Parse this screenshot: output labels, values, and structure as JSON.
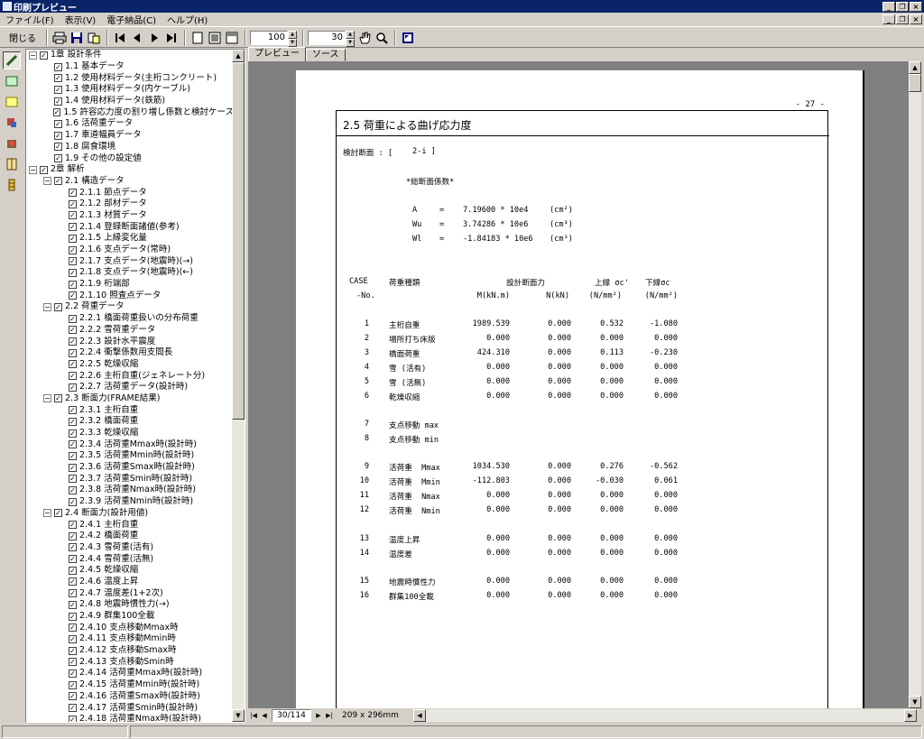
{
  "window": {
    "title": "印刷プレビュー"
  },
  "menu": [
    "ファイル(F)",
    "表示(V)",
    "電子納品(C)",
    "ヘルプ(H)"
  ],
  "toolbar": {
    "close_label": "閉じる",
    "zoom_value": "100",
    "lines_value": "30"
  },
  "tree": [
    {
      "level": 0,
      "label": "1章 設計条件",
      "expanded": true
    },
    {
      "level": 1,
      "label": "1.1 基本データ"
    },
    {
      "level": 1,
      "label": "1.2 使用材料データ(主桁コンクリート)"
    },
    {
      "level": 1,
      "label": "1.3 使用材料データ(内ケーブル)"
    },
    {
      "level": 1,
      "label": "1.4 使用材料データ(鉄筋)"
    },
    {
      "level": 1,
      "label": "1.5 許容応力度の割り増し係数と検討ケース"
    },
    {
      "level": 1,
      "label": "1.6 活荷重データ"
    },
    {
      "level": 1,
      "label": "1.7 車道幅員データ"
    },
    {
      "level": 1,
      "label": "1.8 腐食環境"
    },
    {
      "level": 1,
      "label": "1.9 その他の設定値"
    },
    {
      "level": 0,
      "label": "2章 解析",
      "expanded": true
    },
    {
      "level": 1,
      "label": "2.1 構造データ",
      "expanded": true
    },
    {
      "level": 2,
      "label": "2.1.1 節点データ"
    },
    {
      "level": 2,
      "label": "2.1.2 部材データ"
    },
    {
      "level": 2,
      "label": "2.1.3 材質データ"
    },
    {
      "level": 2,
      "label": "2.1.4 登録断面諸値(参考)"
    },
    {
      "level": 2,
      "label": "2.1.5 上縁変化量"
    },
    {
      "level": 2,
      "label": "2.1.6 支点データ(常時)"
    },
    {
      "level": 2,
      "label": "2.1.7 支点データ(地震時)(→)"
    },
    {
      "level": 2,
      "label": "2.1.8 支点データ(地震時)(←)"
    },
    {
      "level": 2,
      "label": "2.1.9 桁端部"
    },
    {
      "level": 2,
      "label": "2.1.10 照査点データ"
    },
    {
      "level": 1,
      "label": "2.2 荷重データ",
      "expanded": true
    },
    {
      "level": 2,
      "label": "2.2.1 橋面荷重扱いの分布荷重"
    },
    {
      "level": 2,
      "label": "2.2.2 雪荷重データ"
    },
    {
      "level": 2,
      "label": "2.2.3 設計水平震度"
    },
    {
      "level": 2,
      "label": "2.2.4 衝撃係数用支間長"
    },
    {
      "level": 2,
      "label": "2.2.5 乾燥収縮"
    },
    {
      "level": 2,
      "label": "2.2.6 主桁自重(ジェネレート分)"
    },
    {
      "level": 2,
      "label": "2.2.7 活荷重データ(設計時)"
    },
    {
      "level": 1,
      "label": "2.3 断面力(FRAME結果)",
      "expanded": true
    },
    {
      "level": 2,
      "label": "2.3.1 主桁自重"
    },
    {
      "level": 2,
      "label": "2.3.2 橋面荷重"
    },
    {
      "level": 2,
      "label": "2.3.3 乾燥収縮"
    },
    {
      "level": 2,
      "label": "2.3.4 活荷重Mmax時(設計時)"
    },
    {
      "level": 2,
      "label": "2.3.5 活荷重Mmin時(設計時)"
    },
    {
      "level": 2,
      "label": "2.3.6 活荷重Smax時(設計時)"
    },
    {
      "level": 2,
      "label": "2.3.7 活荷重Smin時(設計時)"
    },
    {
      "level": 2,
      "label": "2.3.8 活荷重Nmax時(設計時)"
    },
    {
      "level": 2,
      "label": "2.3.9 活荷重Nmin時(設計時)"
    },
    {
      "level": 1,
      "label": "2.4 断面力(設計用値)",
      "expanded": true
    },
    {
      "level": 2,
      "label": "2.4.1 主桁自重"
    },
    {
      "level": 2,
      "label": "2.4.2 橋面荷重"
    },
    {
      "level": 2,
      "label": "2.4.3 雪荷重(活有)"
    },
    {
      "level": 2,
      "label": "2.4.4 雪荷重(活無)"
    },
    {
      "level": 2,
      "label": "2.4.5 乾燥収縮"
    },
    {
      "level": 2,
      "label": "2.4.6 温度上昇"
    },
    {
      "level": 2,
      "label": "2.4.7 温度差(1+2次)"
    },
    {
      "level": 2,
      "label": "2.4.8 地震時慣性力(→)"
    },
    {
      "level": 2,
      "label": "2.4.9 群集100全載"
    },
    {
      "level": 2,
      "label": "2.4.10 支点移動Mmax時"
    },
    {
      "level": 2,
      "label": "2.4.11 支点移動Mmin時"
    },
    {
      "level": 2,
      "label": "2.4.12 支点移動Smax時"
    },
    {
      "level": 2,
      "label": "2.4.13 支点移動Smin時"
    },
    {
      "level": 2,
      "label": "2.4.14 活荷重Mmax時(設計時)"
    },
    {
      "level": 2,
      "label": "2.4.15 活荷重Mmin時(設計時)"
    },
    {
      "level": 2,
      "label": "2.4.16 活荷重Smax時(設計時)"
    },
    {
      "level": 2,
      "label": "2.4.17 活荷重Smin時(設計時)"
    },
    {
      "level": 2,
      "label": "2.4.18 活荷重Nmax時(設計時)"
    }
  ],
  "tabs": {
    "preview": "プレビュー",
    "source": "ソース"
  },
  "page": {
    "page_number": "- 27 -",
    "section_title": "2.5 荷重による曲げ応力度",
    "check_section_label": "検討断面 : [",
    "check_section_value": "2-i ]",
    "props_title": "*総断面係数*",
    "props": [
      {
        "sym": "A",
        "eq": "=",
        "val": "7.19600 * 10e4",
        "unit": "(cm²)"
      },
      {
        "sym": "Wu",
        "eq": "=",
        "val": "3.74286 * 10e6",
        "unit": "(cm³)"
      },
      {
        "sym": "Wl",
        "eq": "=",
        "val": "-1.84183 * 10e6",
        "unit": "(cm³)"
      }
    ],
    "header1": {
      "case": "CASE",
      "type": "荷重種類",
      "design": "設計断面力",
      "upper": "上縁 σc'",
      "lower": "下縁σc"
    },
    "header2": {
      "no": "-No.",
      "m": "M(kN.m)",
      "n": "N(kN)",
      "upper": "(N/mm²)",
      "lower": "(N/mm²)"
    },
    "rows": [
      {
        "no": "1",
        "name": "主桁自重",
        "m": "1989.539",
        "n": "0.000",
        "u": "0.532",
        "l": "-1.080",
        "gap": 0
      },
      {
        "no": "2",
        "name": "場所打ち床版",
        "m": "0.000",
        "n": "0.000",
        "u": "0.000",
        "l": "0.000",
        "gap": 0
      },
      {
        "no": "3",
        "name": "橋面荷重",
        "m": "424.310",
        "n": "0.000",
        "u": "0.113",
        "l": "-0.230",
        "gap": 0
      },
      {
        "no": "4",
        "name": "雪 (活有)",
        "m": "0.000",
        "n": "0.000",
        "u": "0.000",
        "l": "0.000",
        "gap": 0
      },
      {
        "no": "5",
        "name": "雪 (活無)",
        "m": "0.000",
        "n": "0.000",
        "u": "0.000",
        "l": "0.000",
        "gap": 0
      },
      {
        "no": "6",
        "name": "乾燥収縮",
        "m": "0.000",
        "n": "0.000",
        "u": "0.000",
        "l": "0.000",
        "gap": 0
      },
      {
        "no": "7",
        "name": "支点移動 max",
        "m": "",
        "n": "",
        "u": "",
        "l": "",
        "gap": 1
      },
      {
        "no": "8",
        "name": "支点移動 min",
        "m": "",
        "n": "",
        "u": "",
        "l": "",
        "gap": 0
      },
      {
        "no": "9",
        "name": "活荷重  Mmax",
        "m": "1034.530",
        "n": "0.000",
        "u": "0.276",
        "l": "-0.562",
        "gap": 1
      },
      {
        "no": "10",
        "name": "活荷重  Mmin",
        "m": "-112.803",
        "n": "0.000",
        "u": "-0.030",
        "l": "0.061",
        "gap": 0
      },
      {
        "no": "11",
        "name": "活荷重  Nmax",
        "m": "0.000",
        "n": "0.000",
        "u": "0.000",
        "l": "0.000",
        "gap": 0
      },
      {
        "no": "12",
        "name": "活荷重  Nmin",
        "m": "0.000",
        "n": "0.000",
        "u": "0.000",
        "l": "0.000",
        "gap": 0
      },
      {
        "no": "13",
        "name": "温度上昇",
        "m": "0.000",
        "n": "0.000",
        "u": "0.000",
        "l": "0.000",
        "gap": 1
      },
      {
        "no": "14",
        "name": "温度差",
        "m": "0.000",
        "n": "0.000",
        "u": "0.000",
        "l": "0.000",
        "gap": 0
      },
      {
        "no": "15",
        "name": "地震時慣性力",
        "m": "0.000",
        "n": "0.000",
        "u": "0.000",
        "l": "0.000",
        "gap": 1
      },
      {
        "no": "16",
        "name": "群集100全載",
        "m": "0.000",
        "n": "0.000",
        "u": "0.000",
        "l": "0.000",
        "gap": 0
      }
    ]
  },
  "nav": {
    "page_field": "30/114",
    "paper_size": "209 x 296mm"
  },
  "colors": {
    "titlebar": "#0a246a",
    "face": "#d4d0c8",
    "preview_bg": "#808080"
  }
}
